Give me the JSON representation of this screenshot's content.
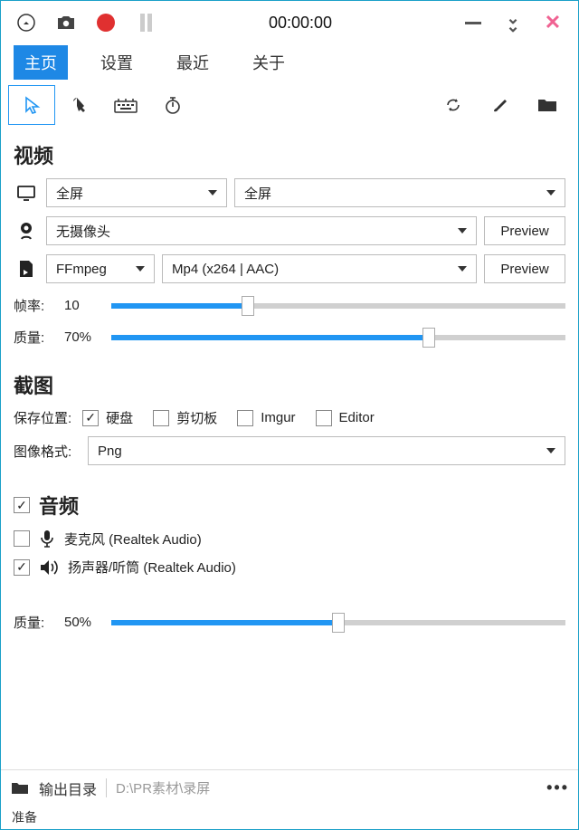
{
  "topbar": {
    "timer": "00:00:00"
  },
  "tabs": {
    "home": "主页",
    "settings": "设置",
    "recent": "最近",
    "about": "关于"
  },
  "sections": {
    "video": "视频",
    "screenshot": "截图",
    "audio": "音频"
  },
  "video": {
    "screen_mode": "全屏",
    "screen_target": "全屏",
    "camera": "无摄像头",
    "preview_btn": "Preview",
    "encoder": "FFmpeg",
    "format": "Mp4 (x264 | AAC)",
    "framerate_label": "帧率:",
    "framerate_value": "10",
    "framerate_percent": 30,
    "quality_label": "质量:",
    "quality_value": "70%",
    "quality_percent": 70
  },
  "screenshot": {
    "save_to_label": "保存位置:",
    "disk": "硬盘",
    "clipboard": "剪切板",
    "imgur": "Imgur",
    "editor": "Editor",
    "disk_checked": true,
    "format_label": "图像格式:",
    "format_value": "Png"
  },
  "audio": {
    "enabled": true,
    "mic_label": "麦克风 (Realtek Audio)",
    "mic_checked": false,
    "speaker_label": "扬声器/听筒 (Realtek Audio)",
    "speaker_checked": true,
    "quality_label": "质量:",
    "quality_value": "50%",
    "quality_percent": 50
  },
  "bottom": {
    "output_label": "输出目录",
    "path": "D:\\PR素材\\录屏"
  },
  "status": "准备"
}
